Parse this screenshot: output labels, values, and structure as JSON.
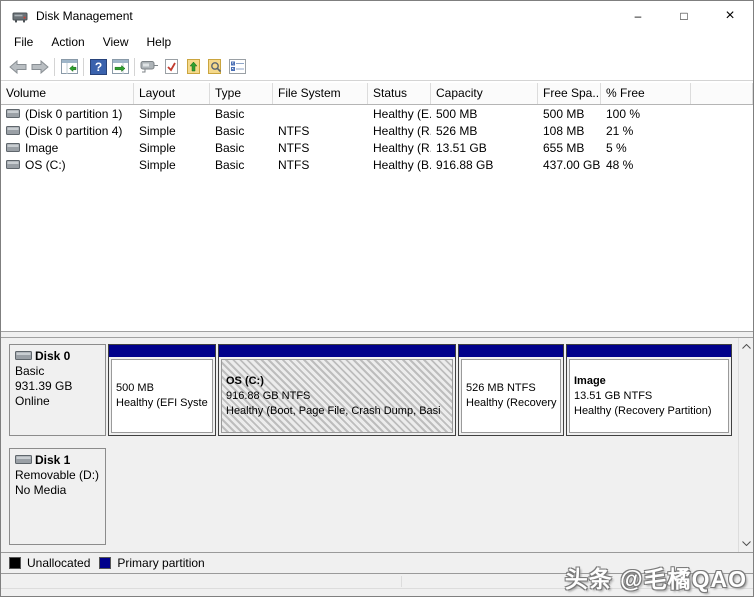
{
  "window": {
    "title": "Disk Management",
    "controls": {
      "minimize": "–",
      "maximize": "□",
      "close": "×"
    }
  },
  "menu": {
    "items": [
      {
        "label": "File"
      },
      {
        "label": "Action"
      },
      {
        "label": "View"
      },
      {
        "label": "Help"
      }
    ]
  },
  "toolbar": {
    "icons": [
      "back-arrow",
      "forward-arrow",
      "show-console-tree",
      "help",
      "show-action-pane",
      "popup-window",
      "check-document",
      "export-list",
      "find",
      "properties-list"
    ]
  },
  "volume_list": {
    "columns": [
      {
        "label": "Volume"
      },
      {
        "label": "Layout"
      },
      {
        "label": "Type"
      },
      {
        "label": "File System"
      },
      {
        "label": "Status"
      },
      {
        "label": "Capacity"
      },
      {
        "label": "Free Spa..."
      },
      {
        "label": "% Free"
      },
      {
        "label": ""
      }
    ],
    "rows": [
      {
        "volume": "(Disk 0 partition 1)",
        "layout": "Simple",
        "type": "Basic",
        "file_system": "",
        "status": "Healthy (E...",
        "capacity": "500 MB",
        "free_space": "500 MB",
        "percent_free": "100 %"
      },
      {
        "volume": "(Disk 0 partition 4)",
        "layout": "Simple",
        "type": "Basic",
        "file_system": "NTFS",
        "status": "Healthy (R...",
        "capacity": "526 MB",
        "free_space": "108 MB",
        "percent_free": "21 %"
      },
      {
        "volume": "Image",
        "layout": "Simple",
        "type": "Basic",
        "file_system": "NTFS",
        "status": "Healthy (R...",
        "capacity": "13.51 GB",
        "free_space": "655 MB",
        "percent_free": "5 %"
      },
      {
        "volume": "OS (C:)",
        "layout": "Simple",
        "type": "Basic",
        "file_system": "NTFS",
        "status": "Healthy (B...",
        "capacity": "916.88 GB",
        "free_space": "437.00 GB",
        "percent_free": "48 %"
      }
    ]
  },
  "graphical_view": {
    "disks": [
      {
        "name": "Disk 0",
        "type": "Basic",
        "size": "931.39 GB",
        "status": "Online",
        "partitions": [
          {
            "name": "",
            "size_line": "500 MB",
            "status_line": "Healthy (EFI Syste",
            "selected": false
          },
          {
            "name": "OS (C:)",
            "size_line": "916.88 GB NTFS",
            "status_line": "Healthy (Boot, Page File, Crash Dump, Basi",
            "selected": true
          },
          {
            "name": "",
            "size_line": "526 MB NTFS",
            "status_line": "Healthy (Recovery",
            "selected": false
          },
          {
            "name": "Image",
            "size_line": "13.51 GB NTFS",
            "status_line": "Healthy (Recovery Partition)",
            "selected": false
          }
        ]
      },
      {
        "name": "Disk 1",
        "type": "Removable (D:)",
        "size": "",
        "status": "No Media",
        "partitions": []
      }
    ]
  },
  "legend": {
    "items": [
      {
        "label": "Unallocated",
        "color": "#000000"
      },
      {
        "label": "Primary partition",
        "color": "#00008b"
      }
    ]
  },
  "watermark": {
    "text": "头条 @毛橘QAO"
  },
  "colors": {
    "primary_partition_bar": "#00008b",
    "unallocated": "#000000",
    "pane_background": "#f0f0f0",
    "selection_hatch": "#bdbdbd"
  }
}
